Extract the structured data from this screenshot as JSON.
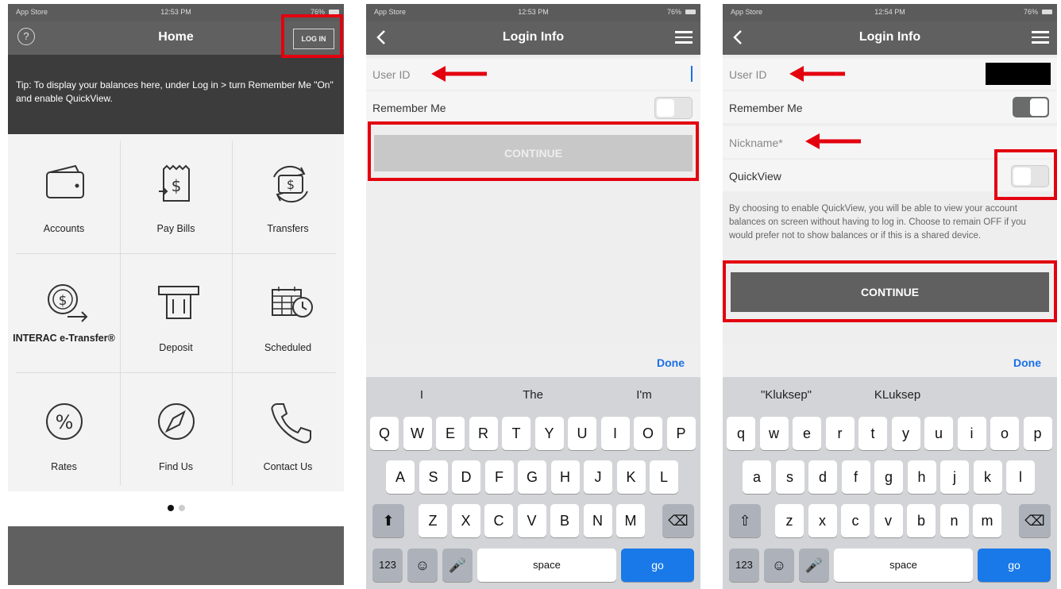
{
  "screen1": {
    "status": {
      "left": "App Store",
      "time": "12:53 PM",
      "battery": "76%"
    },
    "title": "Home",
    "help": "?",
    "login_button": "LOG IN",
    "tip": "Tip: To display your balances here, under Log in > turn Remember Me \"On\" and enable QuickView.",
    "tiles": [
      {
        "label": "Accounts",
        "icon": "wallet-icon"
      },
      {
        "label": "Pay Bills",
        "icon": "bill-icon"
      },
      {
        "label": "Transfers",
        "icon": "transfer-icon"
      },
      {
        "label": "INTERAC e-Transfer®",
        "icon": "etransfer-icon"
      },
      {
        "label": "Deposit",
        "icon": "atm-icon"
      },
      {
        "label": "Scheduled",
        "icon": "calendar-icon"
      },
      {
        "label": "Rates",
        "icon": "percent-icon"
      },
      {
        "label": "Find Us",
        "icon": "compass-icon"
      },
      {
        "label": "Contact Us",
        "icon": "phone-icon"
      }
    ]
  },
  "screen2": {
    "status": {
      "left": "App Store",
      "time": "12:53 PM",
      "battery": "76%"
    },
    "title": "Login Info",
    "user_id_placeholder": "User ID",
    "remember_me": "Remember Me",
    "continue": "CONTINUE",
    "done": "Done",
    "suggestions": [
      "I",
      "The",
      "I'm"
    ],
    "keys_row1": [
      "Q",
      "W",
      "E",
      "R",
      "T",
      "Y",
      "U",
      "I",
      "O",
      "P"
    ],
    "keys_row2": [
      "A",
      "S",
      "D",
      "F",
      "G",
      "H",
      "J",
      "K",
      "L"
    ],
    "keys_row3": [
      "Z",
      "X",
      "C",
      "V",
      "B",
      "N",
      "M"
    ],
    "num_key": "123",
    "space": "space",
    "go": "go"
  },
  "screen3": {
    "status": {
      "left": "App Store",
      "time": "12:54 PM",
      "battery": "76%"
    },
    "title": "Login Info",
    "user_id_placeholder": "User ID",
    "remember_me": "Remember Me",
    "nickname_placeholder": "Nickname*",
    "quickview": "QuickView",
    "description": "By choosing to enable QuickView, you will be able to view your account balances on screen without having to log in. Choose to remain OFF if you would prefer not to show balances or if this is a shared device.",
    "continue": "CONTINUE",
    "done": "Done",
    "suggestions": [
      "\"Kluksep\"",
      "KLuksep"
    ],
    "keys_row1": [
      "q",
      "w",
      "e",
      "r",
      "t",
      "y",
      "u",
      "i",
      "o",
      "p"
    ],
    "keys_row2": [
      "a",
      "s",
      "d",
      "f",
      "g",
      "h",
      "j",
      "k",
      "l"
    ],
    "keys_row3": [
      "z",
      "x",
      "c",
      "v",
      "b",
      "n",
      "m"
    ],
    "num_key": "123",
    "space": "space",
    "go": "go"
  },
  "colors": {
    "bar": "#5f605f",
    "tip_bg": "#3c3c3c",
    "highlight": "#e3000f",
    "go": "#1979e8"
  }
}
